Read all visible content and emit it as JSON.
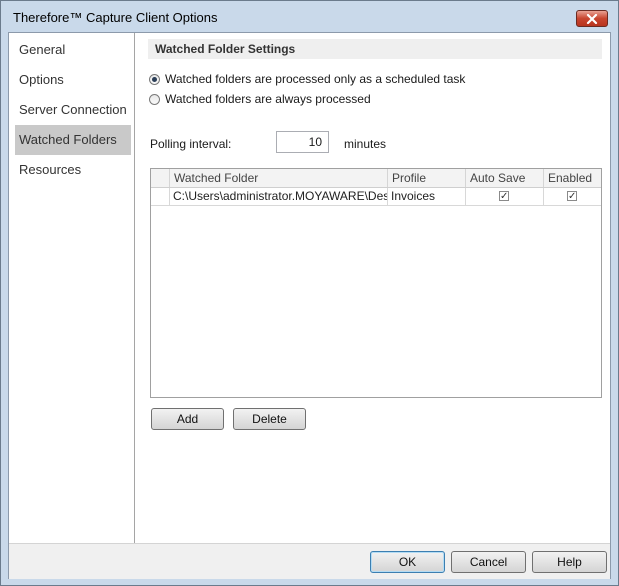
{
  "window": {
    "title": "Therefore™ Capture Client Options"
  },
  "sidebar": {
    "items": [
      {
        "label": "General"
      },
      {
        "label": "Options"
      },
      {
        "label": "Server Connection"
      },
      {
        "label": "Watched Folders",
        "selected": true
      },
      {
        "label": "Resources"
      }
    ]
  },
  "main": {
    "section_title": "Watched Folder Settings",
    "radios": [
      {
        "label": "Watched folders are processed only as a scheduled task",
        "checked": true
      },
      {
        "label": "Watched folders are always processed",
        "checked": false
      }
    ],
    "polling": {
      "label": "Polling interval:",
      "value": "10",
      "unit": "minutes"
    },
    "table": {
      "columns": [
        "Watched Folder",
        "Profile",
        "Auto Save",
        "Enabled"
      ],
      "rows": [
        {
          "folder": "C:\\Users\\administrator.MOYAWARE\\Desk...",
          "profile": "Invoices",
          "auto_save": true,
          "enabled": true
        }
      ]
    },
    "add_label": "Add",
    "delete_label": "Delete"
  },
  "footer": {
    "ok_label": "OK",
    "cancel_label": "Cancel",
    "help_label": "Help"
  },
  "colors": {
    "selected_nav": "#c9c9c9",
    "title_bar": "#c9d9ea",
    "close_button": "#c8452f"
  }
}
